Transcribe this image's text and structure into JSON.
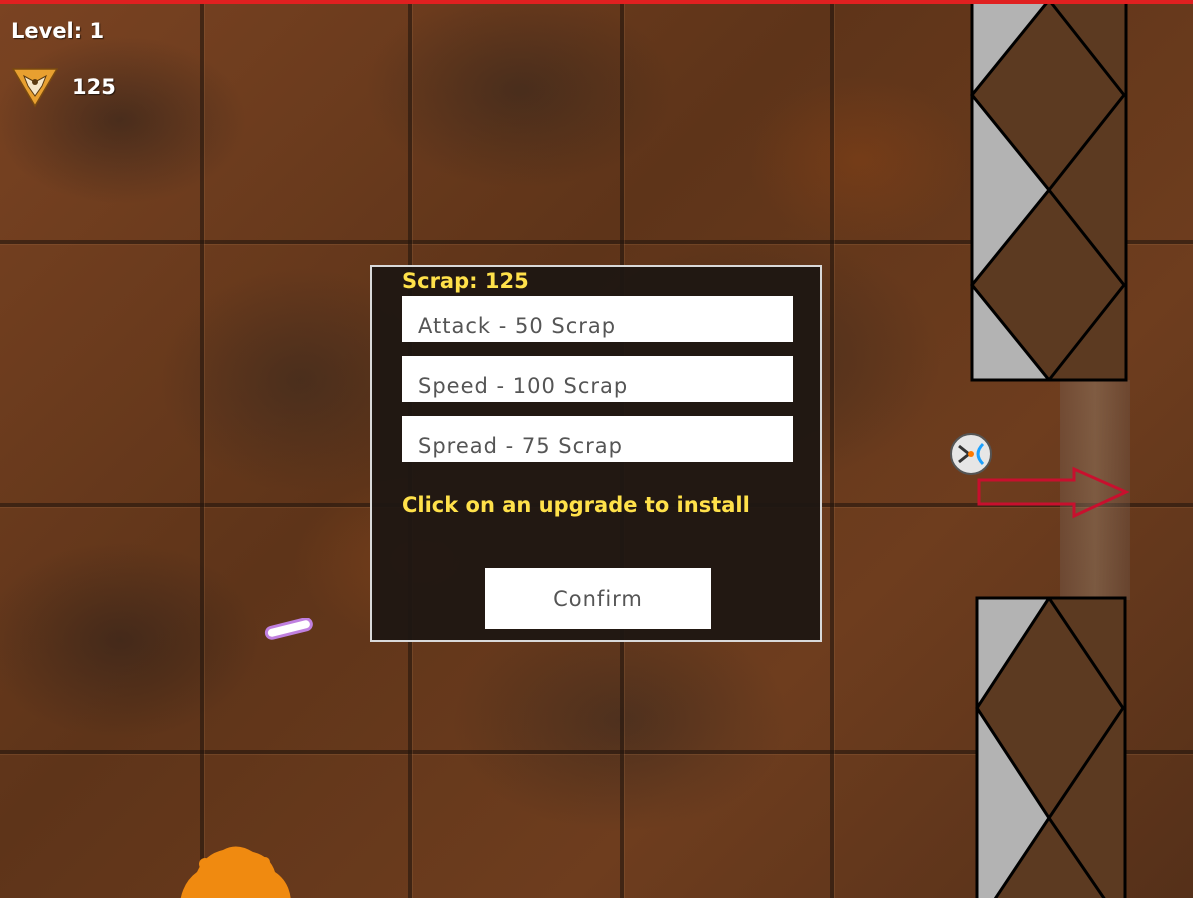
{
  "hud": {
    "level_text": "Level: 1",
    "scrap_count": "125",
    "scrap_icon": "scrap-emblem-icon"
  },
  "upgrade_modal": {
    "scrap_text": "Scrap: 125",
    "upgrades": [
      {
        "label": "Attack - 50 Scrap"
      },
      {
        "label": "Speed - 100 Scrap"
      },
      {
        "label": "Spread - 75 Scrap"
      }
    ],
    "hint": "Click on an upgrade to install",
    "confirm_label": "Confirm"
  },
  "colors": {
    "top_bar": "#e02020",
    "hud_text": "#ffffff",
    "modal_accent_text": "#ffe14a",
    "modal_background": "#1e1612",
    "exit_arrow": "#c8102e",
    "wall_brown": "#5c3a21",
    "wall_gray": "#b3b3b3",
    "scrap_icon": "#e8a030",
    "bullet_outline": "#c080e0"
  }
}
